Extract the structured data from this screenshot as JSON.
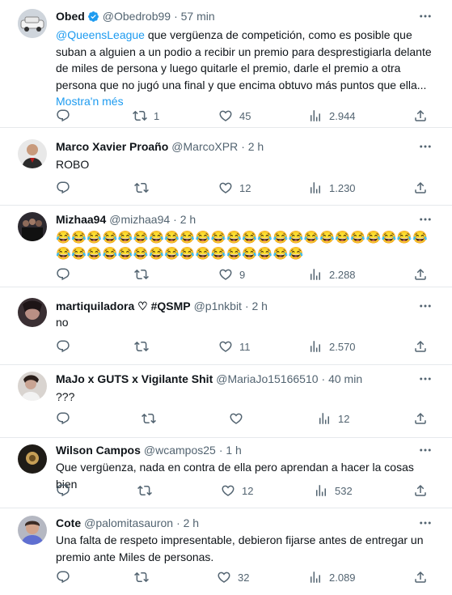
{
  "icons": {
    "reply": "reply-icon",
    "repost": "repost-icon",
    "like": "like-icon",
    "views": "views-icon",
    "share": "share-icon",
    "more": "more-icon",
    "verified": "verified-badge-icon"
  },
  "colors": {
    "link": "#1d9bf0",
    "muted": "#536471",
    "divider": "#e6e9ec"
  },
  "posts": [
    {
      "name": "Obed",
      "handle": "@Obedrob99",
      "time": "· 57 min",
      "mention": "@QueensLeague",
      "text": " que vergüenza de competición, como es posible que suban a alguien a un podio a recibir un premio para desprestigiarla delante de miles de persona y luego quitarle el premio, darle el premio a otra persona que no jugó una final y que encima obtuvo más puntos que ella...",
      "show_more": "Mostra'n més",
      "replies": "",
      "reposts": "1",
      "likes": "45",
      "views": "2.944"
    },
    {
      "name": "Marco Xavier Proaño",
      "handle": "@MarcoXPR",
      "time": "· 2 h",
      "text": "ROBO",
      "replies": "",
      "reposts": "",
      "likes": "12",
      "views": "1.230"
    },
    {
      "name": "Mizhaa94",
      "handle": "@mizhaa94",
      "time": "· 2 h",
      "emoji_line_1": "😂😂😂😂😂😂😂😂😂😂😂😂😂😂😂😂😂😂😂😂😂😂😂😂",
      "emoji_line_2": "😂😂😂😂😂😂😂😂😂😂😂😂😂😂😂😂",
      "replies": "",
      "reposts": "",
      "likes": "9",
      "views": "2.288"
    },
    {
      "name": "martiquiladora ♡ #QSMP",
      "handle": "@p1nkbit",
      "time": "· 2 h",
      "text": "no",
      "replies": "",
      "reposts": "",
      "likes": "11",
      "views": "2.570"
    },
    {
      "name": "MaJo x GUTS x Vigilante Shit",
      "handle": "@MariaJo15166510",
      "time": "· 40 min",
      "text": "???",
      "replies": "",
      "reposts": "",
      "likes": "",
      "views": "12"
    },
    {
      "name": "Wilson Campos",
      "handle": "@wcampos25",
      "time": "· 1 h",
      "text": "Que vergüenza, nada en contra de ella pero aprendan a hacer la cosas bien",
      "replies": "",
      "reposts": "",
      "likes": "12",
      "views": "532"
    },
    {
      "name": "Cote",
      "handle": "@palomitasauron",
      "time": "· 2 h",
      "text": "Una falta de respeto impresentable, debieron fijarse antes de entregar un premio ante Miles de personas.",
      "replies": "",
      "reposts": "",
      "likes": "32",
      "views": "2.089"
    }
  ]
}
